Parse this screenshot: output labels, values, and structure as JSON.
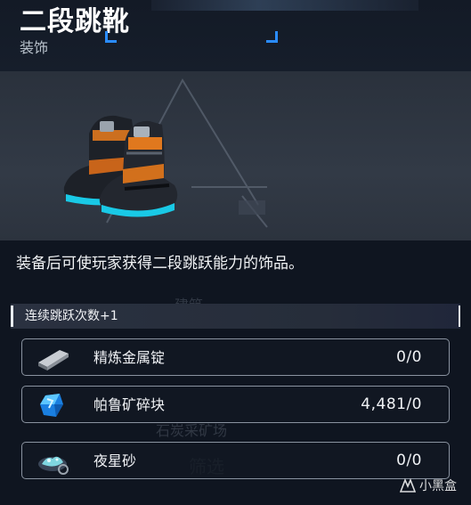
{
  "item": {
    "title": "二段跳靴",
    "category": "装饰",
    "description": "装备后可使玩家获得二段跳跃能力的饰品。",
    "effect": "连续跳跃次数+1"
  },
  "materials": [
    {
      "name": "精炼金属锭",
      "count": "0/0",
      "icon": "metal-ingot-icon"
    },
    {
      "name": "帕鲁矿碎块",
      "count": "4,481/0",
      "icon": "pal-crystal-icon"
    },
    {
      "name": "夜星砂",
      "count": "0/0",
      "icon": "night-star-sand-icon"
    }
  ],
  "background": {
    "build_label": "建筑",
    "filter_label": "筛选",
    "stone_label": "石炭采矿场"
  },
  "watermark": "小黑盒",
  "colors": {
    "accent": "#2a8cff",
    "boot_orange": "#e0781e",
    "boot_glow": "#19c9e6"
  }
}
